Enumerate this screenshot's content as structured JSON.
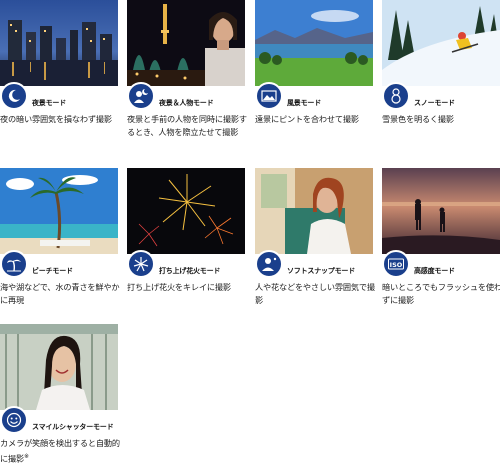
{
  "modes": [
    {
      "id": "night",
      "title": "夜景モード",
      "desc": "夜の暗い雰囲気を損なわず撮影",
      "icon": "crescent-moon-icon"
    },
    {
      "id": "night-portrait",
      "title": "夜景＆人物モード",
      "desc": "夜景と手前の人物を同時に撮影するとき、人物を際立たせて撮影",
      "icon": "person-moon-icon"
    },
    {
      "id": "landscape",
      "title": "風景モード",
      "desc": "遠景にピントを合わせて撮影",
      "icon": "mountain-icon"
    },
    {
      "id": "snow",
      "title": "スノーモード",
      "desc": "雪景色を明るく撮影",
      "icon": "snowman-icon"
    },
    {
      "id": "beach",
      "title": "ビーチモード",
      "desc": "海や湖などで、水の青さを鮮やかに再現",
      "icon": "palm-tree-icon"
    },
    {
      "id": "fireworks",
      "title": "打ち上げ花火モード",
      "desc": "打ち上げ花火をキレイに撮影",
      "icon": "firework-icon"
    },
    {
      "id": "soft-snap",
      "title": "ソフトスナップモード",
      "desc": "人や花などをやさしい雰囲気で撮影",
      "icon": "soft-portrait-icon"
    },
    {
      "id": "high-sensitivity",
      "title": "高感度モード",
      "desc": "暗いところでもフラッシュを使わずに撮影",
      "icon": "iso-icon"
    },
    {
      "id": "smile-shutter",
      "title": "スマイルシャッターモード",
      "desc": "カメラが笑顔を検出すると自動的に撮影",
      "footnote": "※",
      "icon": "smile-face-icon"
    }
  ],
  "colors": {
    "badge": "#1a3f8c",
    "text": "#222222"
  }
}
